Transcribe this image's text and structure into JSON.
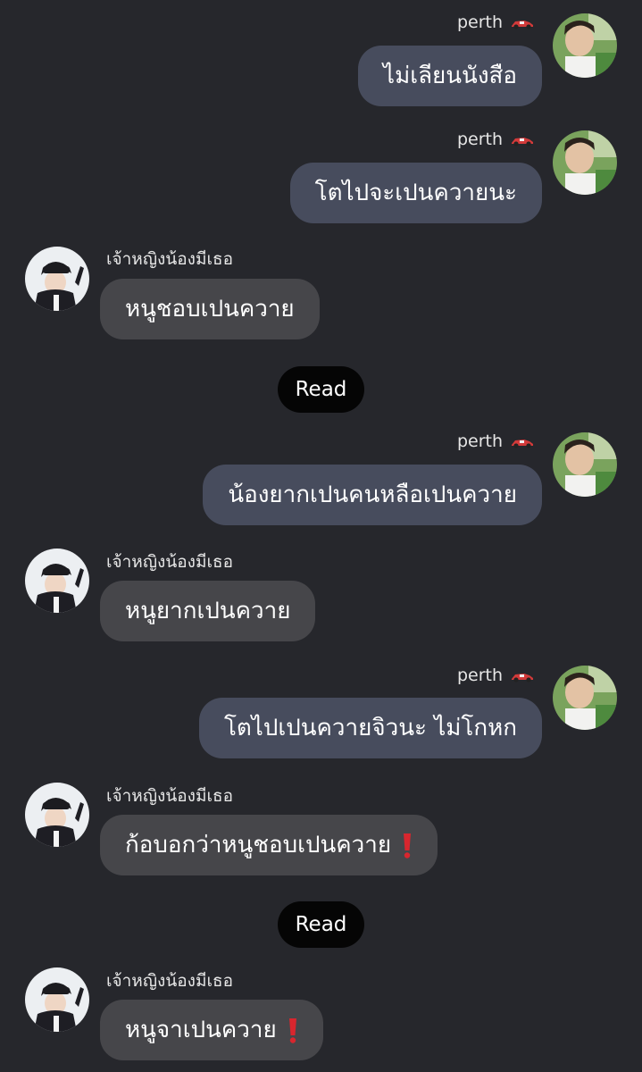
{
  "contacts": {
    "outgoing_name": "perth",
    "incoming_name": "เจ้าหญิงน้องมีเธอ"
  },
  "messages": [
    {
      "text": "ไม่เลียนนังสือ"
    },
    {
      "text": "โตไปจะเปนควายนะ"
    },
    {
      "text": "หนูชอบเปนควาย"
    },
    {
      "text": "น้องยากเปนคนหลือเปนควาย"
    },
    {
      "text": "หนูยากเปนควาย"
    },
    {
      "text": "โตไปเปนควายจิวนะ ไม่โกหก"
    },
    {
      "text": "ก้อบอกว่าหนูชอบเปนควาย"
    },
    {
      "text": "หนูจาเปนควาย"
    }
  ],
  "receipts": {
    "read_1": "Read",
    "read_2": "Read"
  },
  "colors": {
    "background": "#26272c",
    "outgoing_bubble": "#474c5d",
    "incoming_bubble": "#46464a",
    "read_pill": "#050505",
    "exclamation": "#d8262e"
  },
  "icons": {
    "name_badge": "racecar-icon",
    "emphasis": "exclamation-icon"
  }
}
